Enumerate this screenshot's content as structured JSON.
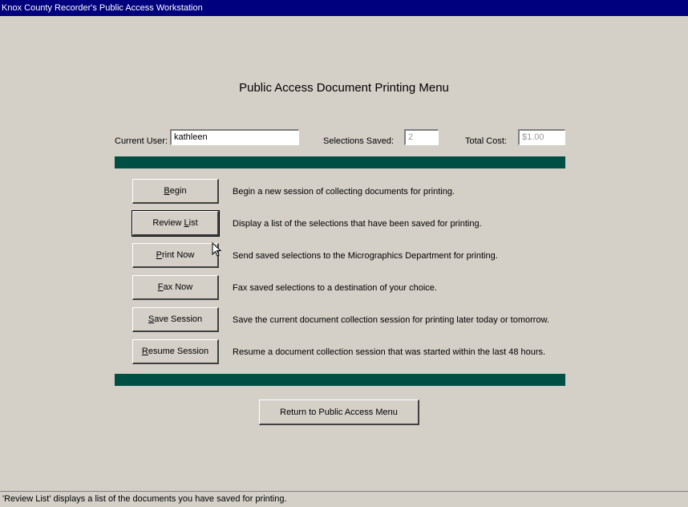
{
  "window": {
    "title": "Knox County Recorder's Public Access Workstation"
  },
  "heading": "Public Access Document Printing Menu",
  "fields": {
    "current_user_label": "Current User:",
    "current_user_value": "kathleen",
    "selections_saved_label": "Selections Saved:",
    "selections_saved_value": "2",
    "total_cost_label": "Total Cost:",
    "total_cost_value": "$1.00"
  },
  "actions": [
    {
      "hotkey": "B",
      "rest": "egin",
      "description": "Begin a new session of collecting documents for printing."
    },
    {
      "pre": "Review ",
      "hotkey": "L",
      "rest": "ist",
      "description": "Display a list of the selections that have been saved for printing."
    },
    {
      "hotkey": "P",
      "rest": "rint Now",
      "description": "Send saved selections to the Micrographics Department for printing."
    },
    {
      "hotkey": "F",
      "rest": "ax Now",
      "description": "Fax saved selections to a destination of your choice."
    },
    {
      "hotkey": "S",
      "rest": "ave Session",
      "description": "Save the current document collection session for printing later today or tomorrow."
    },
    {
      "hotkey": "R",
      "rest": "esume Session",
      "description": "Resume a document collection session that was started within the last 48 hours."
    }
  ],
  "return_button": "Return to Public Access Menu",
  "status": "'Review List' displays a list of the documents you have saved for printing.",
  "colors": {
    "titlebar": "#00007f",
    "divider": "#004f44",
    "background": "#d4d0c8"
  }
}
